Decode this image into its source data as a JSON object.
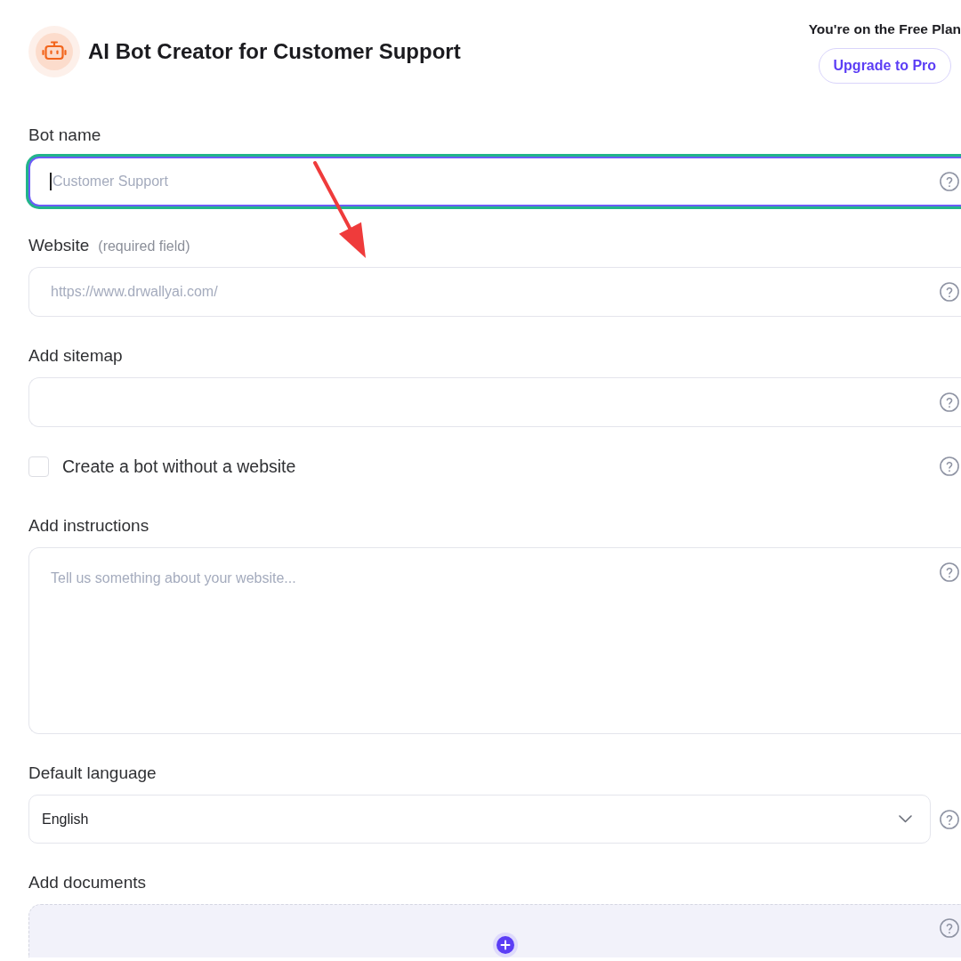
{
  "header": {
    "title": "AI Bot Creator for Customer Support",
    "plan_note": "You're on the Free Plan",
    "upgrade_button": "Upgrade to Pro"
  },
  "fields": [
    {
      "kind": "text",
      "label": "Bot name",
      "placeholder": "Customer Support",
      "focused": true
    },
    {
      "kind": "text",
      "label": "Website",
      "note": "(required field)",
      "placeholder": "https://www.drwallyai.com/",
      "focused": false
    },
    {
      "kind": "text",
      "label": "Add sitemap",
      "focused": false
    },
    {
      "kind": "checkbox",
      "label": "Create a bot without a website",
      "checked": false
    },
    {
      "kind": "textarea",
      "label": "Add instructions",
      "placeholder": "Tell us something about your website..."
    },
    {
      "kind": "select",
      "label": "Default language",
      "value": "English"
    },
    {
      "kind": "upload",
      "label": "Add documents"
    }
  ]
}
